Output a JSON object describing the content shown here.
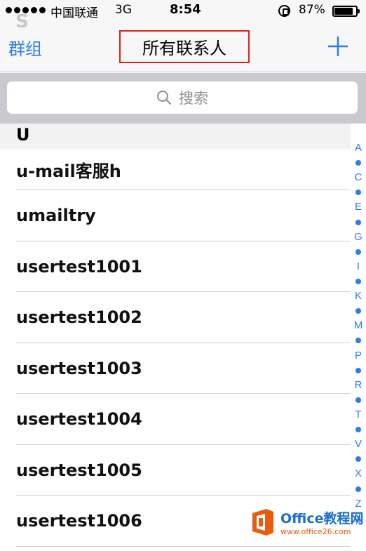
{
  "status_bar": {
    "carrier": "中国联通",
    "network": "3G",
    "time": "8:54",
    "battery_percent": "87%",
    "battery_level": 0.87
  },
  "nav": {
    "ghost_letter": "S",
    "groups_label": "群组",
    "title": "所有联系人",
    "add_icon": "plus-icon"
  },
  "search": {
    "placeholder": "搜索",
    "icon": "search-icon"
  },
  "section": {
    "letter": "U"
  },
  "contacts": [
    "u-mail客服h",
    "umailtry",
    "usertest1001",
    "usertest1002",
    "usertest1003",
    "usertest1004",
    "usertest1005",
    "usertest1006"
  ],
  "index": [
    "A",
    "•",
    "C",
    "•",
    "E",
    "•",
    "G",
    "•",
    "I",
    "•",
    "K",
    "•",
    "M",
    "•",
    "P",
    "•",
    "R",
    "•",
    "T",
    "•",
    "V",
    "•",
    "X",
    "•",
    "Z",
    "#"
  ],
  "watermark": {
    "brand": "Office教程网",
    "url": "www.office26.com"
  },
  "colors": {
    "accent": "#2d7bf4",
    "highlight_border": "#e02020",
    "watermark_orange": "#e85b10",
    "watermark_blue": "#1a6fd1"
  }
}
